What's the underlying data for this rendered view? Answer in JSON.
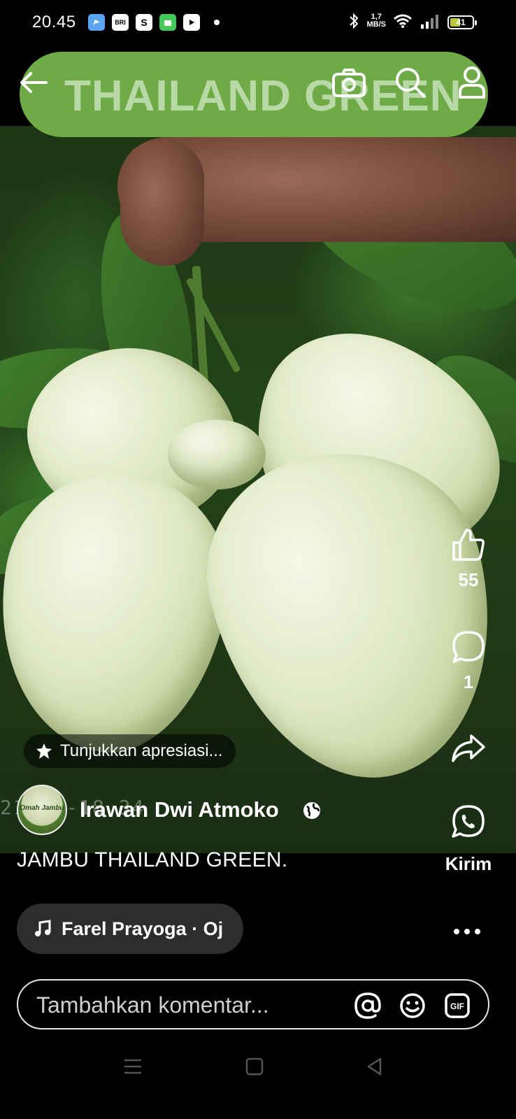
{
  "status_bar": {
    "time": "20.45",
    "apps": [
      "messenger",
      "BRI mo",
      "shopee",
      "wechat-like",
      "youtube"
    ],
    "net_speed_value": "1,7",
    "net_speed_unit": "MB/S",
    "battery": "41"
  },
  "header": {
    "title": "THAILAND GREEN",
    "back_icon": "arrow-left-icon",
    "camera_icon": "camera-icon",
    "search_icon": "search-icon",
    "profile_icon": "profile-icon",
    "pill_color": "#6eab46"
  },
  "media": {
    "watermark": "21-07-18 34"
  },
  "actions": {
    "like_count": "55",
    "comment_count": "1",
    "send_label": "Kirim"
  },
  "appreciation": {
    "label": "Tunjukkan apresiasi..."
  },
  "author": {
    "name": "Irawan Dwi Atmoko",
    "avatar_text": "Omah Jambu"
  },
  "caption": "JAMBU THAILAND GREEN.",
  "music": {
    "label": "Farel Prayoga · Oj"
  },
  "comment": {
    "placeholder": "Tambahkan komentar..."
  }
}
